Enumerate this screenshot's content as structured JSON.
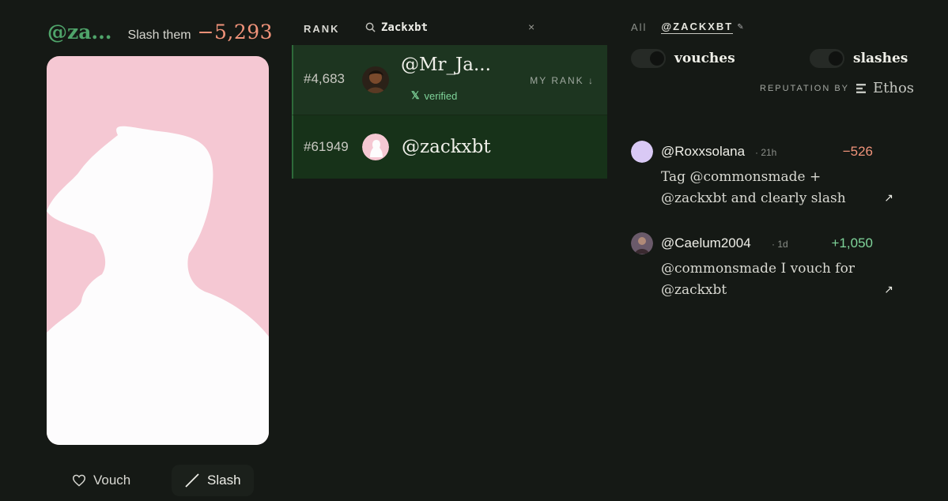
{
  "profile": {
    "handle": "@za...",
    "slash_label": "Slash them",
    "score": "−5,293",
    "avatar_icon": "avatar-silhouette-icon"
  },
  "actions": {
    "vouch_label": "Vouch",
    "slash_label": "Slash",
    "vouch_icon": "heart-icon",
    "slash_icon": "slash-icon"
  },
  "rank": {
    "title": "RANK",
    "search_value": "Zackxbt",
    "search_icon": "search-icon",
    "clear_icon": "close-icon",
    "rows": [
      {
        "rank": "#4,683",
        "name": "@Mr_Ja...",
        "verified_label": "verified",
        "my_rank_label": "MY RANK ↓"
      },
      {
        "rank": "#61949",
        "name": "@zackxbt"
      }
    ]
  },
  "filters": {
    "all_label": "All",
    "user_label": "@ZACKXBT",
    "vouches_label": "vouches",
    "slashes_label": "slashes"
  },
  "reputation": {
    "label": "REPUTATION BY",
    "brand": "Ethos"
  },
  "reviews": [
    {
      "author": "@Roxxsolana",
      "time": "· 21h",
      "score": "−526",
      "text": "Tag @commonsmade + @zackxbt and clearly slash"
    },
    {
      "author": "@Caelum2004",
      "time": "· 1d",
      "score": "+1,050",
      "text": "@commonsmade I vouch for @zackxbt"
    }
  ]
}
